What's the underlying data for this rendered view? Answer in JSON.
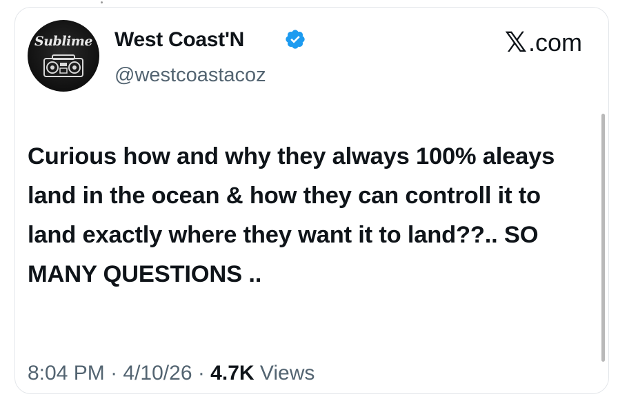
{
  "author": {
    "display_name": "West Coast'N",
    "handle": "@westcoastacoz",
    "verified": true,
    "avatar_text": "Sublime",
    "avatar_icon": "boombox-icon"
  },
  "brand": {
    "logo_icon": "x-logo-icon",
    "logo_glyph": "𝕏",
    "site_label": ".com"
  },
  "tweet": {
    "text": "Curious how and why they always 100% aleays land in the ocean & how they can controll it to land exactly where they want it to land??.. SO MANY QUESTIONS .."
  },
  "meta": {
    "time": "8:04 PM",
    "sep1": " · ",
    "date": "4/10/26",
    "sep2": " · ",
    "views_count": "4.7K",
    "views_label": " Views"
  },
  "colors": {
    "text_primary": "#0f1419",
    "text_secondary": "#536471",
    "verified_blue": "#1d9bf0"
  }
}
